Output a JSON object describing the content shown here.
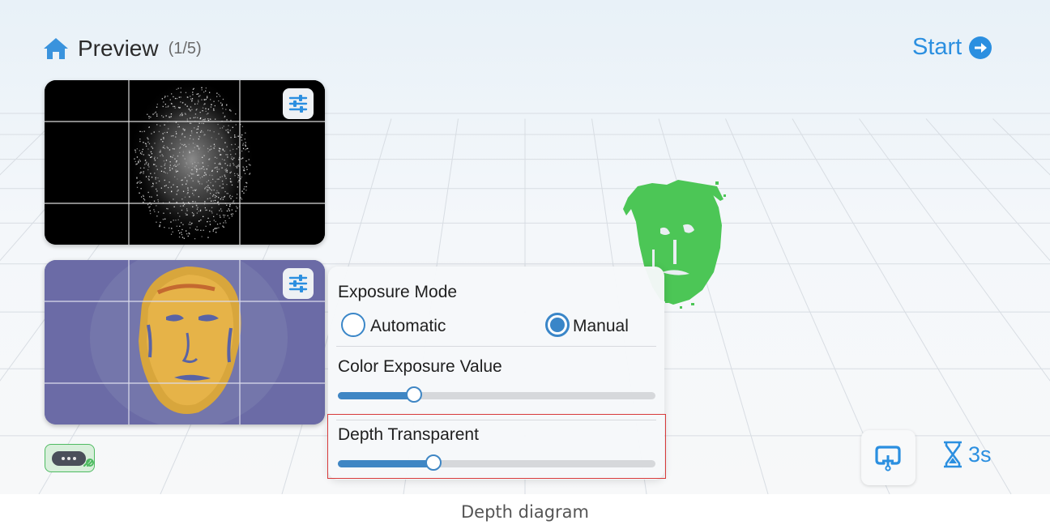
{
  "header": {
    "title": "Preview",
    "count": "(1/5)",
    "home_icon": "home-icon"
  },
  "start_button": {
    "label": "Start",
    "icon": "arrow-right-circle-icon",
    "color": "#2b8fe0"
  },
  "camera_panels": [
    {
      "name": "depth-camera-preview",
      "background": "#000000",
      "icon": "sliders-icon"
    },
    {
      "name": "color-camera-preview",
      "background": "#6a6aa8",
      "icon": "sliders-icon"
    }
  ],
  "exposure_panel": {
    "mode_label": "Exposure Mode",
    "options": [
      {
        "label": "Automatic",
        "selected": false
      },
      {
        "label": "Manual",
        "selected": true
      }
    ],
    "color_exposure": {
      "label": "Color Exposure Value",
      "value": 0.24
    },
    "depth_transparent": {
      "label": "Depth Transparent",
      "value": 0.3
    }
  },
  "device_status": {
    "icon": "device-connected-icon",
    "color": "#4fbb62"
  },
  "tools": {
    "icon": "add-marker-icon"
  },
  "timer": {
    "value": "3s",
    "icon": "hourglass-icon"
  },
  "point_cloud_color": "#4cc656",
  "caption": "Depth diagram"
}
